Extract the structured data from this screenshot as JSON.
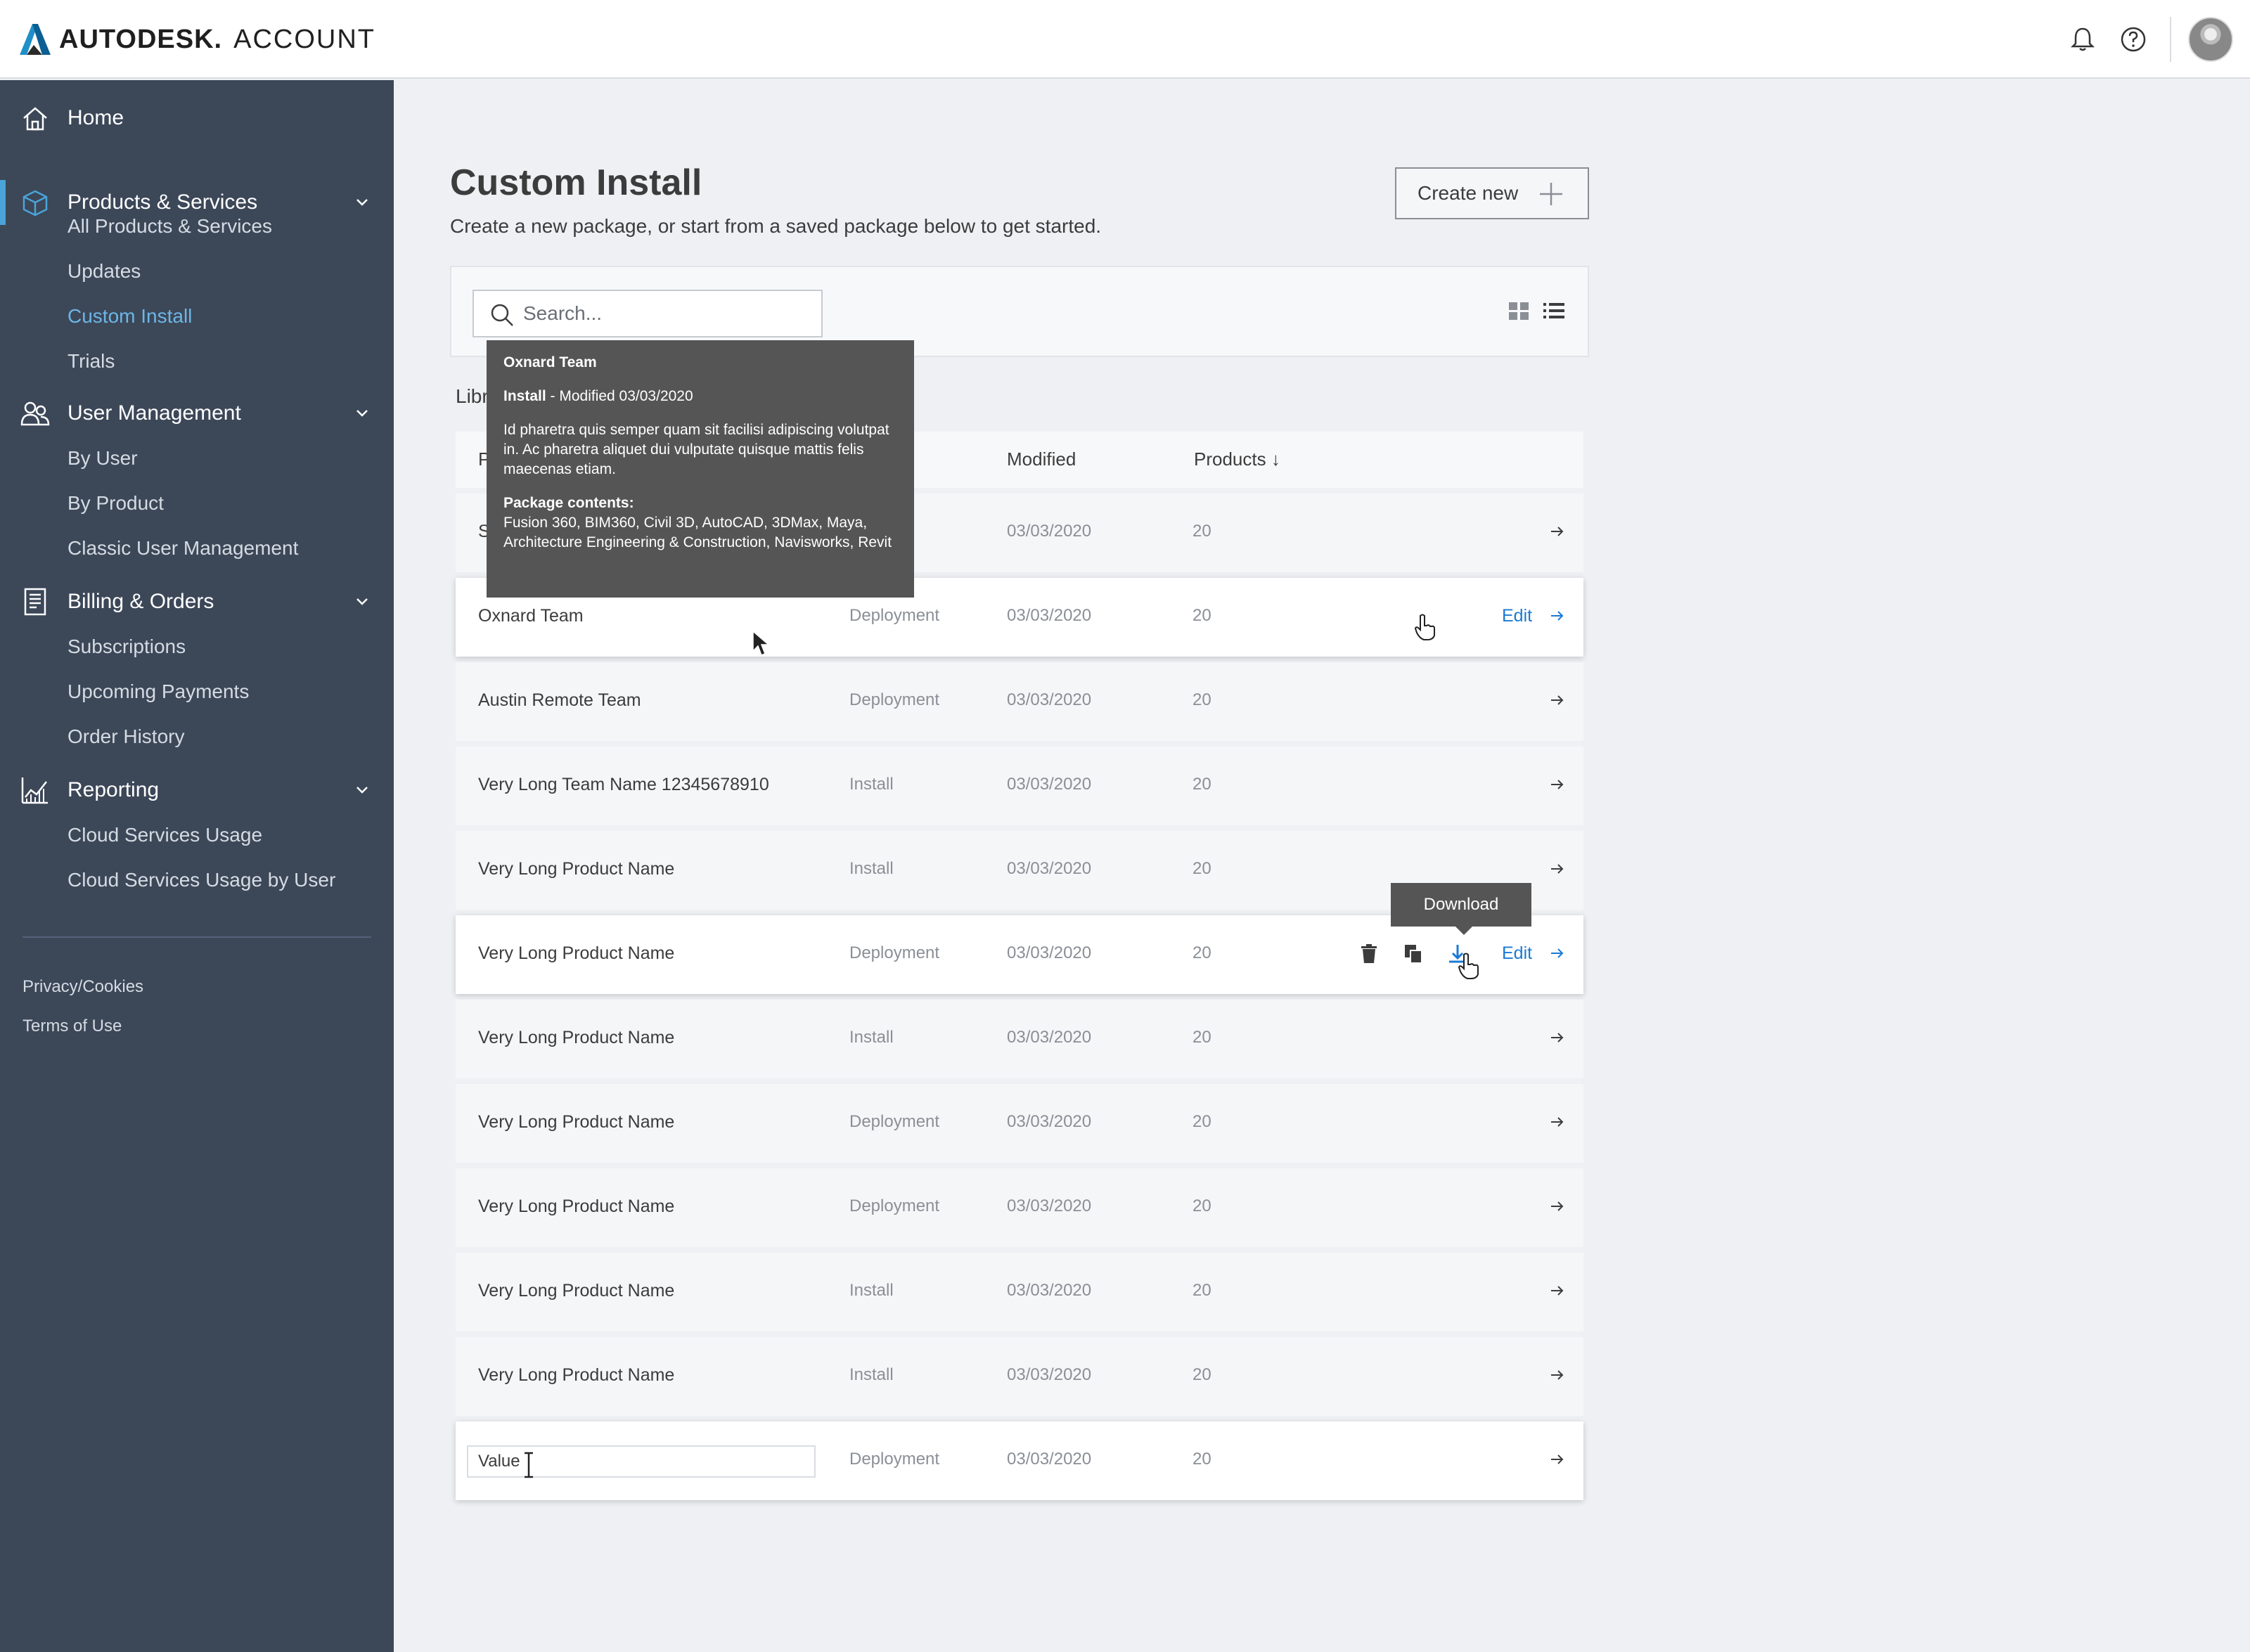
{
  "header": {
    "brand": "AUTODESK.",
    "product": "ACCOUNT",
    "icons": [
      "bell-icon",
      "help-icon",
      "avatar"
    ]
  },
  "sidebar": {
    "sections": [
      {
        "label": "Home",
        "icon": "home-icon"
      },
      {
        "label": "Products & Services",
        "icon": "cube-icon",
        "items": [
          "All Products & Services",
          "Updates",
          "Custom Install",
          "Trials"
        ],
        "active_item": "Custom Install"
      },
      {
        "label": "User Management",
        "icon": "users-icon",
        "items": [
          "By User",
          "By Product",
          "Classic User Management"
        ]
      },
      {
        "label": "Billing & Orders",
        "icon": "receipt-icon",
        "items": [
          "Subscriptions",
          "Upcoming Payments",
          "Order History"
        ]
      },
      {
        "label": "Reporting",
        "icon": "chart-icon",
        "items": [
          "Cloud Services Usage",
          "Cloud Services Usage by User"
        ]
      }
    ],
    "legal": [
      "Privacy/Cookies",
      "Terms of Use"
    ]
  },
  "main": {
    "title": "Custom Install",
    "subtitle": "Create a new package, or start from a saved package below to get started.",
    "create_label": "Create new",
    "search_placeholder": "Search...",
    "library_label": "Libr",
    "columns": {
      "name": "P",
      "modified": "Modified",
      "products": "Products ↓"
    },
    "rows": [
      {
        "name": "S",
        "type": "",
        "modified": "03/03/2020",
        "products": "20"
      },
      {
        "name": "Oxnard Team",
        "type": "Deployment",
        "modified": "03/03/2020",
        "products": "20",
        "edit": "Edit"
      },
      {
        "name": "Austin Remote Team",
        "type": "Deployment",
        "modified": "03/03/2020",
        "products": "20"
      },
      {
        "name": "Very Long Team Name 12345678910",
        "type": "Install",
        "modified": "03/03/2020",
        "products": "20"
      },
      {
        "name": "Very Long Product Name",
        "type": "Install",
        "modified": "03/03/2020",
        "products": "20"
      },
      {
        "name": "Very Long Product Name",
        "type": "Deployment",
        "modified": "03/03/2020",
        "products": "20",
        "edit": "Edit"
      },
      {
        "name": "Very Long Product Name",
        "type": "Install",
        "modified": "03/03/2020",
        "products": "20"
      },
      {
        "name": "Very Long Product Name",
        "type": "Deployment",
        "modified": "03/03/2020",
        "products": "20"
      },
      {
        "name": "Very Long Product Name",
        "type": "Deployment",
        "modified": "03/03/2020",
        "products": "20"
      },
      {
        "name": "Very Long Product Name",
        "type": "Install",
        "modified": "03/03/2020",
        "products": "20"
      },
      {
        "name": "Very Long Product Name",
        "type": "Install",
        "modified": "03/03/2020",
        "products": "20"
      },
      {
        "name": "Value",
        "type": "Deployment",
        "modified": "03/03/2020",
        "products": "20"
      }
    ],
    "name_input_value": "Value"
  },
  "tooltip": {
    "title": "Oxnard Team",
    "type": "Install",
    "modified": " - Modified 03/03/2020",
    "description": "Id pharetra quis semper quam sit facilisi adipiscing volutpat in. Ac pharetra aliquet dui vulputate quisque mattis felis maecenas etiam.",
    "contents_label": "Package contents:",
    "contents": "Fusion 360, BIM360, Civil 3D, AutoCAD, 3DMax, Maya, Architecture Engineering & Construction, Navisworks, Revit"
  },
  "download_tooltip": "Download",
  "colors": {
    "sidebar": "#3c4758",
    "accent": "#4aa4d9",
    "link": "#1a7ad4",
    "tooltip": "#555555"
  }
}
